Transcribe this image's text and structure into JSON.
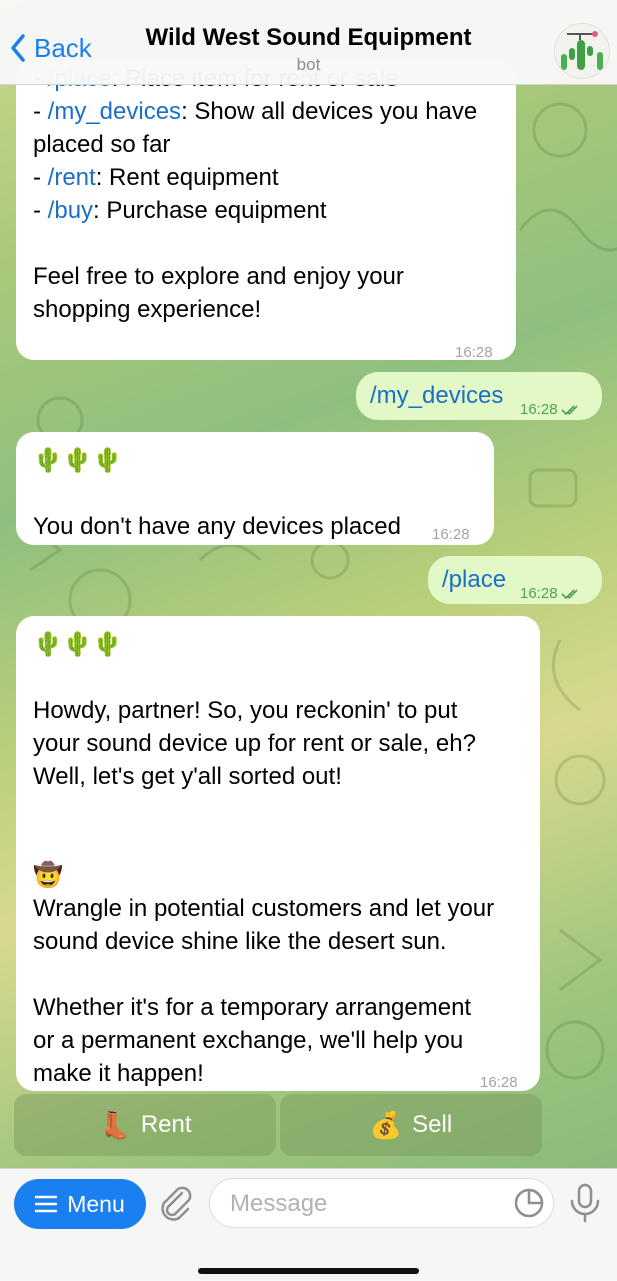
{
  "header": {
    "back_label": "Back",
    "title": "Wild West Sound Equipment",
    "subtitle": "bot"
  },
  "messages": [
    {
      "direction": "in",
      "lines": [
        [
          {
            "t": "- "
          },
          {
            "t": "/place",
            "cmd": true
          },
          {
            "t": ": Place item for rent or sale"
          }
        ],
        [
          {
            "t": "- "
          },
          {
            "t": "/my_devices",
            "cmd": true
          },
          {
            "t": ": Show all devices you have"
          }
        ],
        [
          {
            "t": "placed so far"
          }
        ],
        [
          {
            "t": "- "
          },
          {
            "t": "/rent",
            "cmd": true
          },
          {
            "t": ": Rent equipment"
          }
        ],
        [
          {
            "t": "- "
          },
          {
            "t": "/buy",
            "cmd": true
          },
          {
            "t": ": Purchase equipment"
          }
        ],
        [
          {
            "t": ""
          }
        ],
        [
          {
            "t": "Feel free to explore and enjoy your"
          }
        ],
        [
          {
            "t": "shopping experience!"
          }
        ]
      ],
      "time": "16:28"
    },
    {
      "direction": "out",
      "lines": [
        [
          {
            "t": "/my_devices",
            "cmd": true
          }
        ]
      ],
      "time": "16:28"
    },
    {
      "direction": "in",
      "lines": [
        [
          {
            "t": "🌵🌵🌵"
          }
        ],
        [
          {
            "t": ""
          }
        ],
        [
          {
            "t": "You don't have any devices placed"
          }
        ]
      ],
      "time": "16:28"
    },
    {
      "direction": "out",
      "lines": [
        [
          {
            "t": "/place",
            "cmd": true
          }
        ]
      ],
      "time": "16:28"
    },
    {
      "direction": "in",
      "lines": [
        [
          {
            "t": "🌵🌵🌵"
          }
        ],
        [
          {
            "t": ""
          }
        ],
        [
          {
            "t": "Howdy, partner! So, you reckonin' to put"
          }
        ],
        [
          {
            "t": "your sound device up for rent or sale, eh?"
          }
        ],
        [
          {
            "t": "Well, let's get y'all sorted out!"
          }
        ],
        [
          {
            "t": ""
          }
        ],
        [
          {
            "t": ""
          }
        ],
        [
          {
            "t": "🤠"
          }
        ],
        [
          {
            "t": "Wrangle in potential customers and let your"
          }
        ],
        [
          {
            "t": "sound device shine like the desert sun."
          }
        ],
        [
          {
            "t": ""
          }
        ],
        [
          {
            "t": "Whether it's for a temporary arrangement"
          }
        ],
        [
          {
            "t": "or a permanent exchange, we'll help you"
          }
        ],
        [
          {
            "t": "make it happen!"
          }
        ]
      ],
      "time": "16:28"
    }
  ],
  "keyboard": {
    "rent": {
      "emoji": "👢",
      "label": "Rent"
    },
    "sell": {
      "emoji": "💰",
      "label": "Sell"
    }
  },
  "input": {
    "menu_label": "Menu",
    "placeholder": "Message"
  },
  "colors": {
    "accent": "#1a7ff0",
    "command_link": "#1b6fc9",
    "outgoing_bubble": "#e2f8c6",
    "outgoing_time": "#4fa24c"
  }
}
